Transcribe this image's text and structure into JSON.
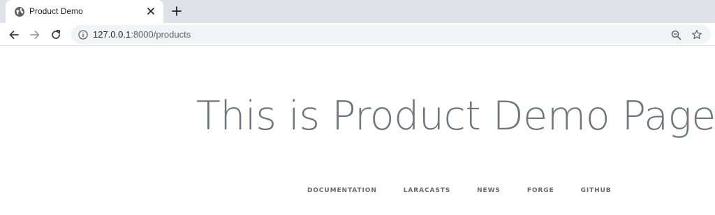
{
  "browser": {
    "tab": {
      "title": "Product Demo",
      "favicon": "globe-icon"
    },
    "toolbar": {
      "url_host": "127.0.0.1",
      "url_rest": ":8000/products"
    }
  },
  "page": {
    "heading": "This is Product Demo Page",
    "links": [
      "DOCUMENTATION",
      "LARACASTS",
      "NEWS",
      "FORGE",
      "GITHUB"
    ]
  },
  "colors": {
    "tabstrip": "#dee1e6",
    "omnibox": "#f1f3f4",
    "heading": "#707579",
    "links": "#636b6f"
  }
}
